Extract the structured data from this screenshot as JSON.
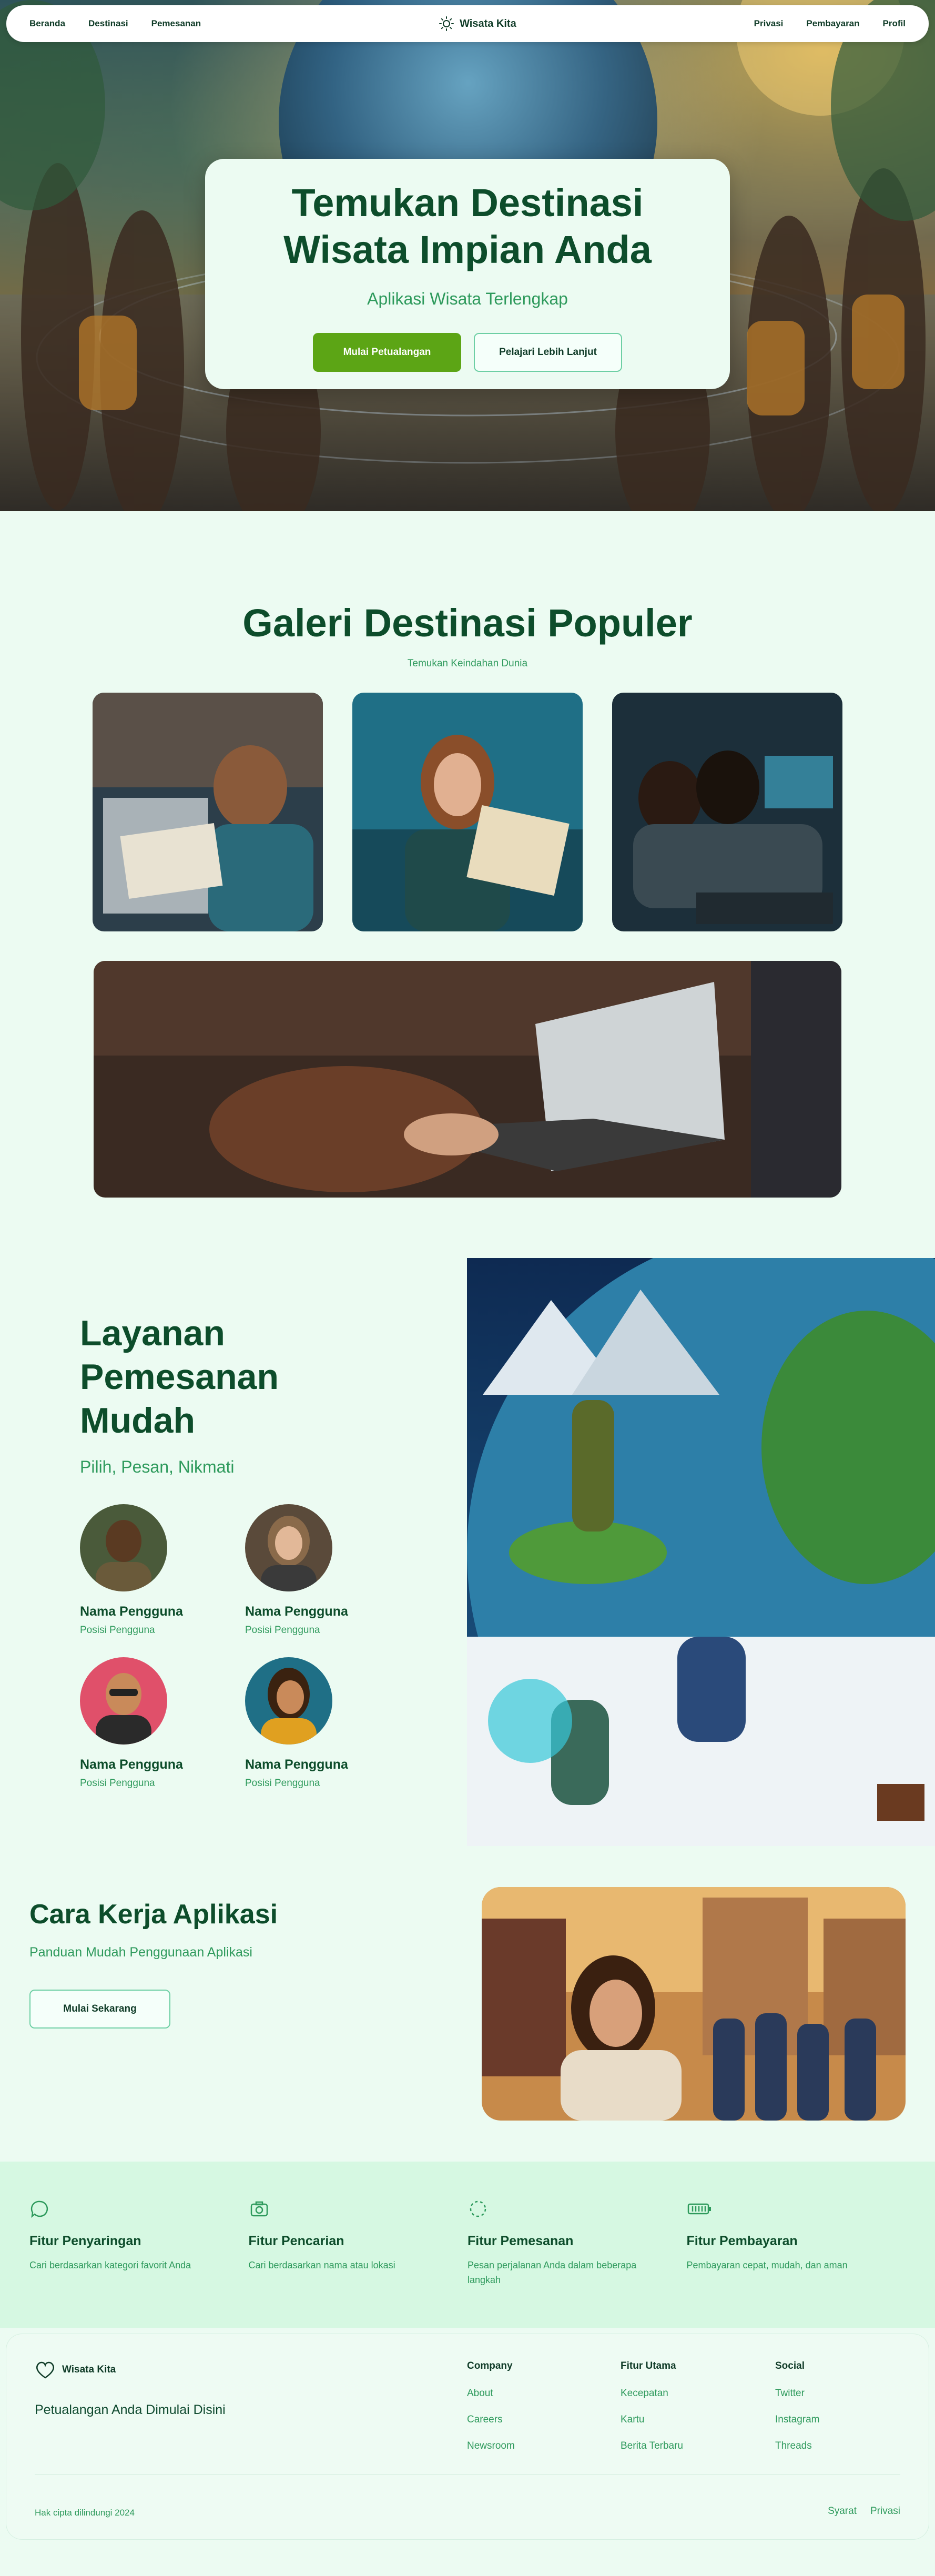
{
  "nav": {
    "left": [
      "Beranda",
      "Destinasi",
      "Pemesanan"
    ],
    "brand": "Wisata Kita",
    "brand_icon": "sun-icon",
    "right": [
      "Privasi",
      "Pembayaran",
      "Profil"
    ]
  },
  "hero": {
    "title_line1": "Temukan Destinasi",
    "title_line2": "Wisata Impian Anda",
    "subtitle": "Aplikasi Wisata Terlengkap",
    "primary_button": "Mulai Petualangan",
    "secondary_button": "Pelajari Lebih Lanjut"
  },
  "gallery": {
    "title": "Galeri Destinasi Populer",
    "subtitle": "Temukan Keindahan Dunia"
  },
  "services": {
    "title": "Layanan Pemesanan Mudah",
    "subtitle": "Pilih, Pesan, Nikmati",
    "members": [
      {
        "name": "Nama Pengguna",
        "position": "Posisi Pengguna"
      },
      {
        "name": "Nama Pengguna",
        "position": "Posisi Pengguna"
      },
      {
        "name": "Nama Pengguna",
        "position": "Posisi Pengguna"
      },
      {
        "name": "Nama Pengguna",
        "position": "Posisi Pengguna"
      }
    ]
  },
  "how": {
    "title": "Cara Kerja Aplikasi",
    "subtitle": "Panduan Mudah Penggunaan Aplikasi",
    "button": "Mulai Sekarang"
  },
  "features": [
    {
      "icon": "chat-bubble-icon",
      "title": "Fitur Penyaringan",
      "desc": "Cari berdasarkan kategori favorit Anda"
    },
    {
      "icon": "camera-icon",
      "title": "Fitur Pencarian",
      "desc": "Cari berdasarkan nama atau lokasi"
    },
    {
      "icon": "loading-circle-icon",
      "title": "Fitur Pemesanan",
      "desc": "Pesan perjalanan Anda dalam beberapa langkah"
    },
    {
      "icon": "battery-icon",
      "title": "Fitur Pembayaran",
      "desc": "Pembayaran cepat, mudah, dan aman"
    }
  ],
  "footer": {
    "brand": "Wisata Kita",
    "brand_icon": "heart-icon",
    "tagline": "Petualangan Anda Dimulai Disini",
    "columns": [
      {
        "title": "Company",
        "links": [
          "About",
          "Careers",
          "Newsroom"
        ]
      },
      {
        "title": "Fitur Utama",
        "links": [
          "Kecepatan",
          "Kartu",
          "Berita Terbaru"
        ]
      },
      {
        "title": "Social",
        "links": [
          "Twitter",
          "Instagram",
          "Threads"
        ]
      }
    ],
    "copyright": "Hak cipta dilindungi 2024",
    "legal": [
      "Syarat",
      "Privasi"
    ]
  },
  "colors": {
    "primary_green": "#5ca515",
    "heading_green": "#0d4d2b",
    "accent_green": "#2e9a5c",
    "background": "#ecfbf2",
    "feature_band": "#d6f8e2"
  }
}
